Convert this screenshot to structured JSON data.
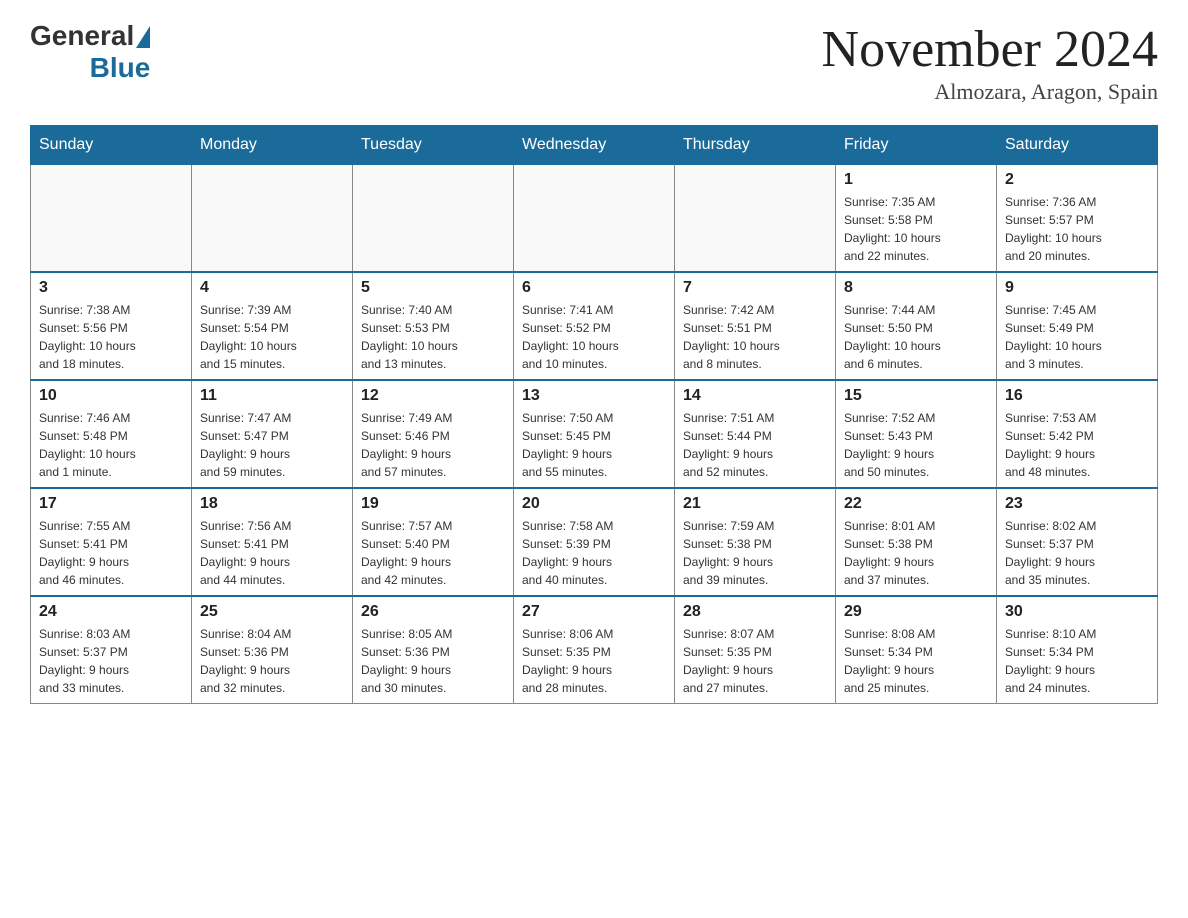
{
  "header": {
    "logo_general": "General",
    "logo_blue": "Blue",
    "month": "November 2024",
    "location": "Almozara, Aragon, Spain"
  },
  "days_of_week": [
    "Sunday",
    "Monday",
    "Tuesday",
    "Wednesday",
    "Thursday",
    "Friday",
    "Saturday"
  ],
  "weeks": [
    [
      {
        "day": "",
        "info": ""
      },
      {
        "day": "",
        "info": ""
      },
      {
        "day": "",
        "info": ""
      },
      {
        "day": "",
        "info": ""
      },
      {
        "day": "",
        "info": ""
      },
      {
        "day": "1",
        "info": "Sunrise: 7:35 AM\nSunset: 5:58 PM\nDaylight: 10 hours\nand 22 minutes."
      },
      {
        "day": "2",
        "info": "Sunrise: 7:36 AM\nSunset: 5:57 PM\nDaylight: 10 hours\nand 20 minutes."
      }
    ],
    [
      {
        "day": "3",
        "info": "Sunrise: 7:38 AM\nSunset: 5:56 PM\nDaylight: 10 hours\nand 18 minutes."
      },
      {
        "day": "4",
        "info": "Sunrise: 7:39 AM\nSunset: 5:54 PM\nDaylight: 10 hours\nand 15 minutes."
      },
      {
        "day": "5",
        "info": "Sunrise: 7:40 AM\nSunset: 5:53 PM\nDaylight: 10 hours\nand 13 minutes."
      },
      {
        "day": "6",
        "info": "Sunrise: 7:41 AM\nSunset: 5:52 PM\nDaylight: 10 hours\nand 10 minutes."
      },
      {
        "day": "7",
        "info": "Sunrise: 7:42 AM\nSunset: 5:51 PM\nDaylight: 10 hours\nand 8 minutes."
      },
      {
        "day": "8",
        "info": "Sunrise: 7:44 AM\nSunset: 5:50 PM\nDaylight: 10 hours\nand 6 minutes."
      },
      {
        "day": "9",
        "info": "Sunrise: 7:45 AM\nSunset: 5:49 PM\nDaylight: 10 hours\nand 3 minutes."
      }
    ],
    [
      {
        "day": "10",
        "info": "Sunrise: 7:46 AM\nSunset: 5:48 PM\nDaylight: 10 hours\nand 1 minute."
      },
      {
        "day": "11",
        "info": "Sunrise: 7:47 AM\nSunset: 5:47 PM\nDaylight: 9 hours\nand 59 minutes."
      },
      {
        "day": "12",
        "info": "Sunrise: 7:49 AM\nSunset: 5:46 PM\nDaylight: 9 hours\nand 57 minutes."
      },
      {
        "day": "13",
        "info": "Sunrise: 7:50 AM\nSunset: 5:45 PM\nDaylight: 9 hours\nand 55 minutes."
      },
      {
        "day": "14",
        "info": "Sunrise: 7:51 AM\nSunset: 5:44 PM\nDaylight: 9 hours\nand 52 minutes."
      },
      {
        "day": "15",
        "info": "Sunrise: 7:52 AM\nSunset: 5:43 PM\nDaylight: 9 hours\nand 50 minutes."
      },
      {
        "day": "16",
        "info": "Sunrise: 7:53 AM\nSunset: 5:42 PM\nDaylight: 9 hours\nand 48 minutes."
      }
    ],
    [
      {
        "day": "17",
        "info": "Sunrise: 7:55 AM\nSunset: 5:41 PM\nDaylight: 9 hours\nand 46 minutes."
      },
      {
        "day": "18",
        "info": "Sunrise: 7:56 AM\nSunset: 5:41 PM\nDaylight: 9 hours\nand 44 minutes."
      },
      {
        "day": "19",
        "info": "Sunrise: 7:57 AM\nSunset: 5:40 PM\nDaylight: 9 hours\nand 42 minutes."
      },
      {
        "day": "20",
        "info": "Sunrise: 7:58 AM\nSunset: 5:39 PM\nDaylight: 9 hours\nand 40 minutes."
      },
      {
        "day": "21",
        "info": "Sunrise: 7:59 AM\nSunset: 5:38 PM\nDaylight: 9 hours\nand 39 minutes."
      },
      {
        "day": "22",
        "info": "Sunrise: 8:01 AM\nSunset: 5:38 PM\nDaylight: 9 hours\nand 37 minutes."
      },
      {
        "day": "23",
        "info": "Sunrise: 8:02 AM\nSunset: 5:37 PM\nDaylight: 9 hours\nand 35 minutes."
      }
    ],
    [
      {
        "day": "24",
        "info": "Sunrise: 8:03 AM\nSunset: 5:37 PM\nDaylight: 9 hours\nand 33 minutes."
      },
      {
        "day": "25",
        "info": "Sunrise: 8:04 AM\nSunset: 5:36 PM\nDaylight: 9 hours\nand 32 minutes."
      },
      {
        "day": "26",
        "info": "Sunrise: 8:05 AM\nSunset: 5:36 PM\nDaylight: 9 hours\nand 30 minutes."
      },
      {
        "day": "27",
        "info": "Sunrise: 8:06 AM\nSunset: 5:35 PM\nDaylight: 9 hours\nand 28 minutes."
      },
      {
        "day": "28",
        "info": "Sunrise: 8:07 AM\nSunset: 5:35 PM\nDaylight: 9 hours\nand 27 minutes."
      },
      {
        "day": "29",
        "info": "Sunrise: 8:08 AM\nSunset: 5:34 PM\nDaylight: 9 hours\nand 25 minutes."
      },
      {
        "day": "30",
        "info": "Sunrise: 8:10 AM\nSunset: 5:34 PM\nDaylight: 9 hours\nand 24 minutes."
      }
    ]
  ]
}
